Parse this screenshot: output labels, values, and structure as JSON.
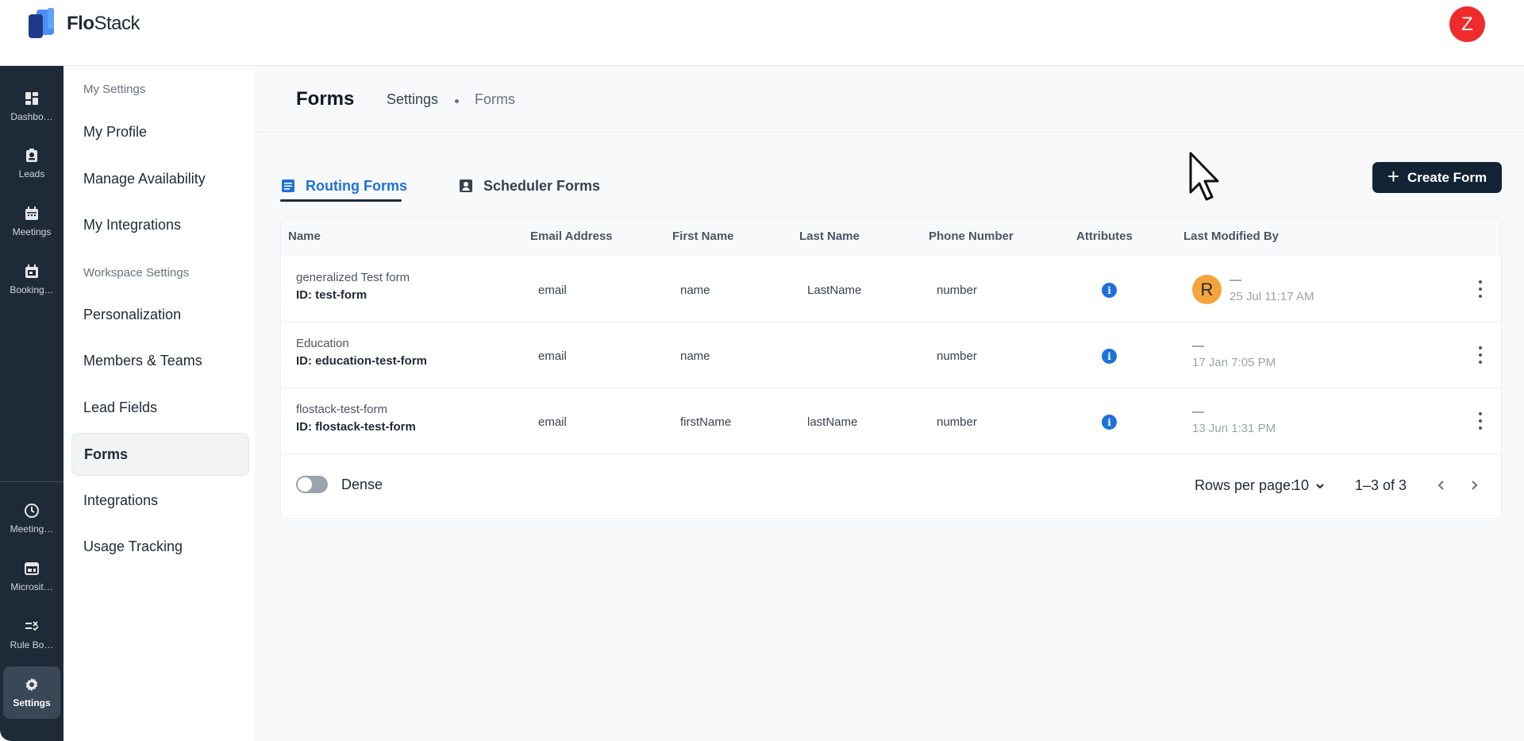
{
  "app": {
    "logo_bold": "Flo",
    "logo_rest": "Stack",
    "user_initial": "Z"
  },
  "rail": {
    "items": [
      {
        "label": "Dashbo…",
        "icon": "dashboard-icon"
      },
      {
        "label": "Leads",
        "icon": "leads-icon"
      },
      {
        "label": "Meetings",
        "icon": "calendar-icon"
      },
      {
        "label": "Booking…",
        "icon": "booking-calendar-icon"
      },
      {
        "label": "Meeting…",
        "icon": "clock-icon"
      },
      {
        "label": "Microsit…",
        "icon": "microsite-icon"
      },
      {
        "label": "Rule Bo…",
        "icon": "rule-icon"
      },
      {
        "label": "Settings",
        "icon": "gear-icon",
        "active": true
      }
    ]
  },
  "settings_nav": {
    "my_settings_header": "My Settings",
    "workspace_settings_header": "Workspace Settings",
    "items": [
      "My Profile",
      "Manage Availability",
      "My Integrations",
      "Personalization",
      "Members & Teams",
      "Lead Fields",
      "Forms",
      "Integrations",
      "Usage Tracking"
    ],
    "active": "Forms"
  },
  "header": {
    "title": "Forms",
    "breadcrumb": [
      "Settings",
      "Forms"
    ]
  },
  "tabs": [
    {
      "label": "Routing Forms",
      "active": true
    },
    {
      "label": "Scheduler Forms",
      "active": false
    }
  ],
  "create_button": "Create Form",
  "table": {
    "columns": [
      "Name",
      "Email Address",
      "First Name",
      "Last Name",
      "Phone Number",
      "Attributes",
      "Last Modified By"
    ],
    "rows": [
      {
        "name": "generalized Test form",
        "id": "ID: test-form",
        "email": "email",
        "first": "name",
        "last": "LastName",
        "phone": "number",
        "modifier_initial": "R",
        "modifier": "—",
        "modified": "25 Jul 11:17 AM"
      },
      {
        "name": "Education",
        "id": "ID: education-test-form",
        "email": "email",
        "first": "name",
        "last": "",
        "phone": "number",
        "modifier_initial": "",
        "modifier": "—",
        "modified": "17 Jan 7:05 PM"
      },
      {
        "name": "flostack-test-form",
        "id": "ID: flostack-test-form",
        "email": "email",
        "first": "firstName",
        "last": "lastName",
        "phone": "number",
        "modifier_initial": "",
        "modifier": "—",
        "modified": "13 Jun 1:31 PM"
      }
    ]
  },
  "footer": {
    "dense_label": "Dense",
    "rows_per_page_label": "Rows per page:",
    "rows_per_page": "10",
    "range": "1–3 of 3"
  },
  "colors": {
    "accent": "#1d72d9",
    "rail_bg": "#1e2a38",
    "primary_button": "#122433",
    "avatar_user": "#ef2b2b",
    "avatar_modifier": "#f5a33a"
  }
}
